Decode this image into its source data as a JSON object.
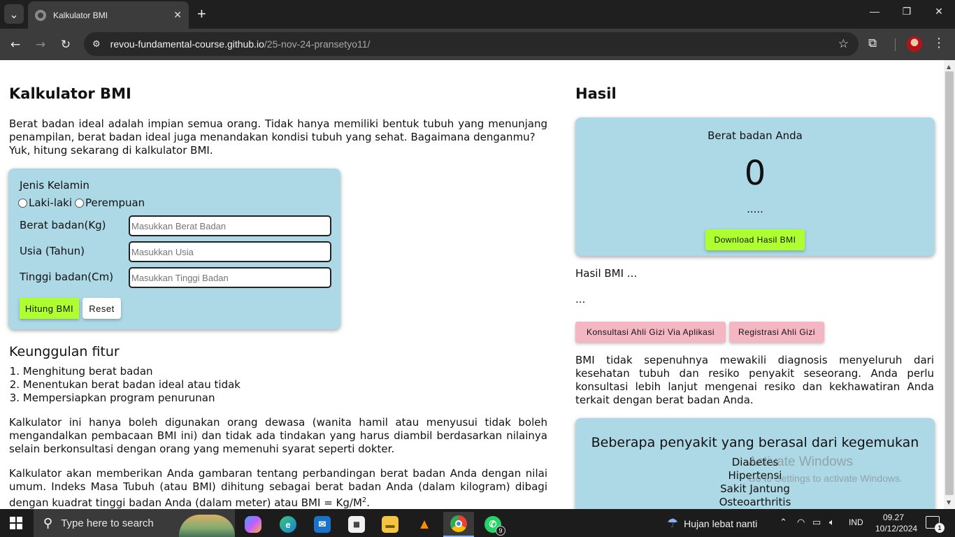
{
  "browser": {
    "tab_title": "Kalkulator BMI",
    "url_host": "revou-fundamental-course.github.io",
    "url_path": "/25-nov-24-pransetyo11/"
  },
  "page": {
    "title": "Kalkulator BMI",
    "intro_line1": "Berat badan ideal adalah impian semua orang. Tidak hanya memiliki bentuk tubuh yang menunjang penampilan, berat badan ideal juga menandakan kondisi tubuh yang sehat. Bagaimana denganmu?",
    "intro_line2": "Yuk, hitung sekarang di kalkulator BMI."
  },
  "form": {
    "gender_label": "Jenis Kelamin",
    "gender_options": [
      "Laki-laki",
      "Perempuan"
    ],
    "weight_label": "Berat badan(Kg)",
    "weight_placeholder": "Masukkan Berat Badan",
    "age_label": "Usia (Tahun)",
    "age_placeholder": "Masukkan Usia",
    "height_label": "Tinggi badan(Cm)",
    "height_placeholder": "Masukkan Tinggi Badan",
    "calculate_label": "Hitung BMI",
    "reset_label": "Reset"
  },
  "features": {
    "title": "Keunggulan fitur",
    "items": [
      "Menghitung berat badan",
      "Menentukan berat badan ideal atau tidak",
      "Mempersiapkan program penurunan"
    ]
  },
  "notes": {
    "para1": "Kalkulator ini hanya boleh digunakan orang dewasa (wanita hamil atau menyusui tidak boleh mengandalkan pembacaan BMI ini) dan tidak ada tindakan yang harus diambil berdasarkan nilainya selain berkonsultasi dengan orang yang memenuhi syarat seperti dokter.",
    "para2": "Kalkulator akan memberikan Anda gambaran tentang perbandingan berat badan Anda dengan nilai umum. Indeks Masa Tubuh (atau BMI) dihitung sebagai berat badan Anda (dalam kilogram) dibagi dengan kuadrat tinggi badan Anda (dalam meter) atau BMI = Kg/M",
    "para2_sup": "2",
    "para2_end": "."
  },
  "result": {
    "title": "Hasil",
    "subtitle": "Berat badan Anda",
    "value": "0",
    "dots": ".....",
    "download_label": "Download Hasil BMI",
    "hasil_bmi": "Hasil BMI ...",
    "hasil_desc": "...",
    "consult_label": "Konsultasi Ahli Gizi Via Aplikasi",
    "register_label": "Registrasi Ahli Gizi",
    "disclaimer": "BMI tidak sepenuhnya mewakili diagnosis menyeluruh dari kesehatan tubuh dan resiko penyakit seseorang. Anda perlu konsultasi lebih lanjut mengenai resiko dan kekhawatiran Anda terkait dengan berat badan Anda."
  },
  "diseases": {
    "title": "Beberapa penyakit yang berasal dari kegemukan",
    "items": [
      "Diabetes",
      "Hipertensi",
      "Sakit Jantung",
      "Osteoarthritis"
    ]
  },
  "watermark": {
    "title": "Activate Windows",
    "subtitle": "Go to Settings to activate Windows."
  },
  "taskbar": {
    "search_placeholder": "Type here to search",
    "weather": "Hujan lebat nanti",
    "language": "IND",
    "time": "09.27",
    "date": "10/12/2024",
    "whatsapp_badge": "9",
    "notifications": "1"
  },
  "colors": {
    "card_bg": "#add8e6",
    "lime_button": "#adff2f",
    "pink_button": "#f4b6c2"
  }
}
